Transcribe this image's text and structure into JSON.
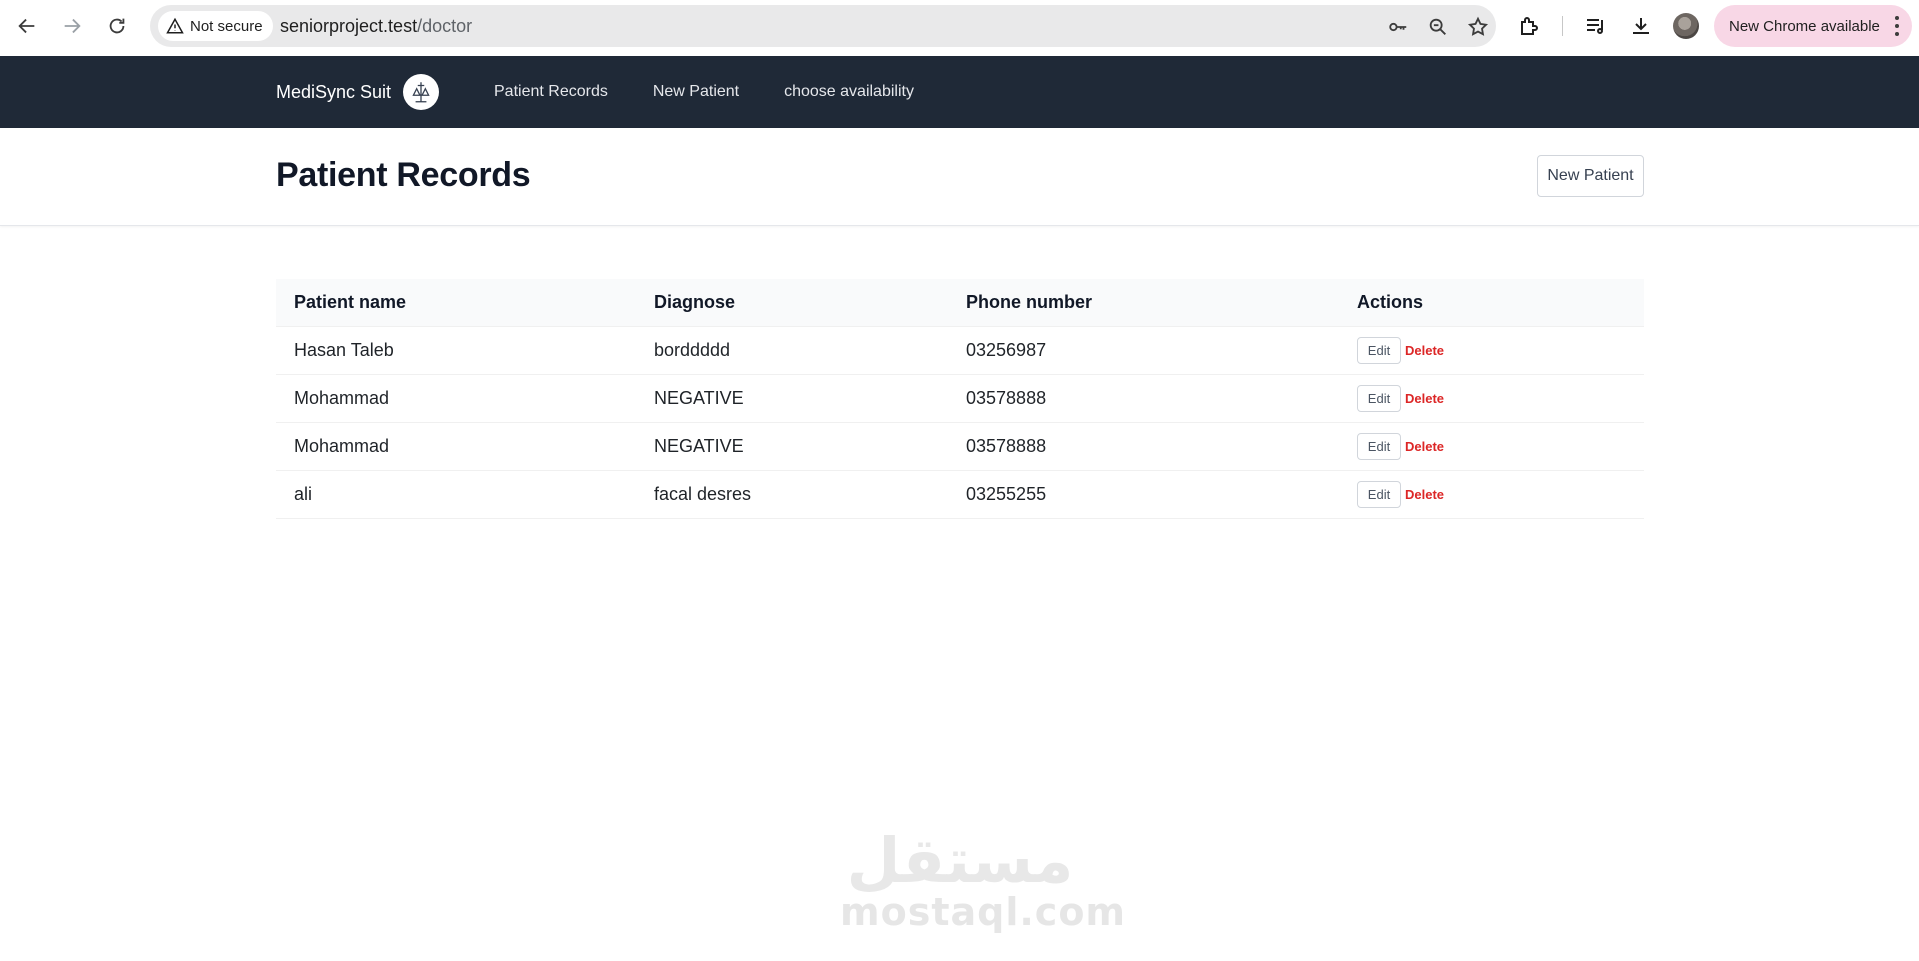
{
  "browser": {
    "security_label": "Not secure",
    "url_host": "seniorproject.test",
    "url_path": "/doctor",
    "update_label": "New Chrome available"
  },
  "nav": {
    "brand": "MediSync Suit",
    "links": [
      "Patient Records",
      "New Patient",
      "choose availability"
    ]
  },
  "header": {
    "title": "Patient Records",
    "new_patient_label": "New Patient"
  },
  "table": {
    "columns": [
      "Patient name",
      "Diagnose",
      "Phone number",
      "Actions"
    ],
    "rows": [
      {
        "name": "Hasan Taleb",
        "diagnose": "borddddd",
        "phone": "03256987"
      },
      {
        "name": "Mohammad",
        "diagnose": "NEGATIVE",
        "phone": "03578888"
      },
      {
        "name": "Mohammad",
        "diagnose": "NEGATIVE",
        "phone": "03578888"
      },
      {
        "name": "ali",
        "diagnose": "facal desres",
        "phone": "03255255"
      }
    ],
    "edit_label": "Edit",
    "delete_label": "Delete"
  },
  "watermark": {
    "arabic": "مستقل",
    "latin": "mostaql.com"
  },
  "colors": {
    "navbar_bg": "#1f2937",
    "delete_red": "#dc2626",
    "update_chip": "#f8d7e6"
  }
}
